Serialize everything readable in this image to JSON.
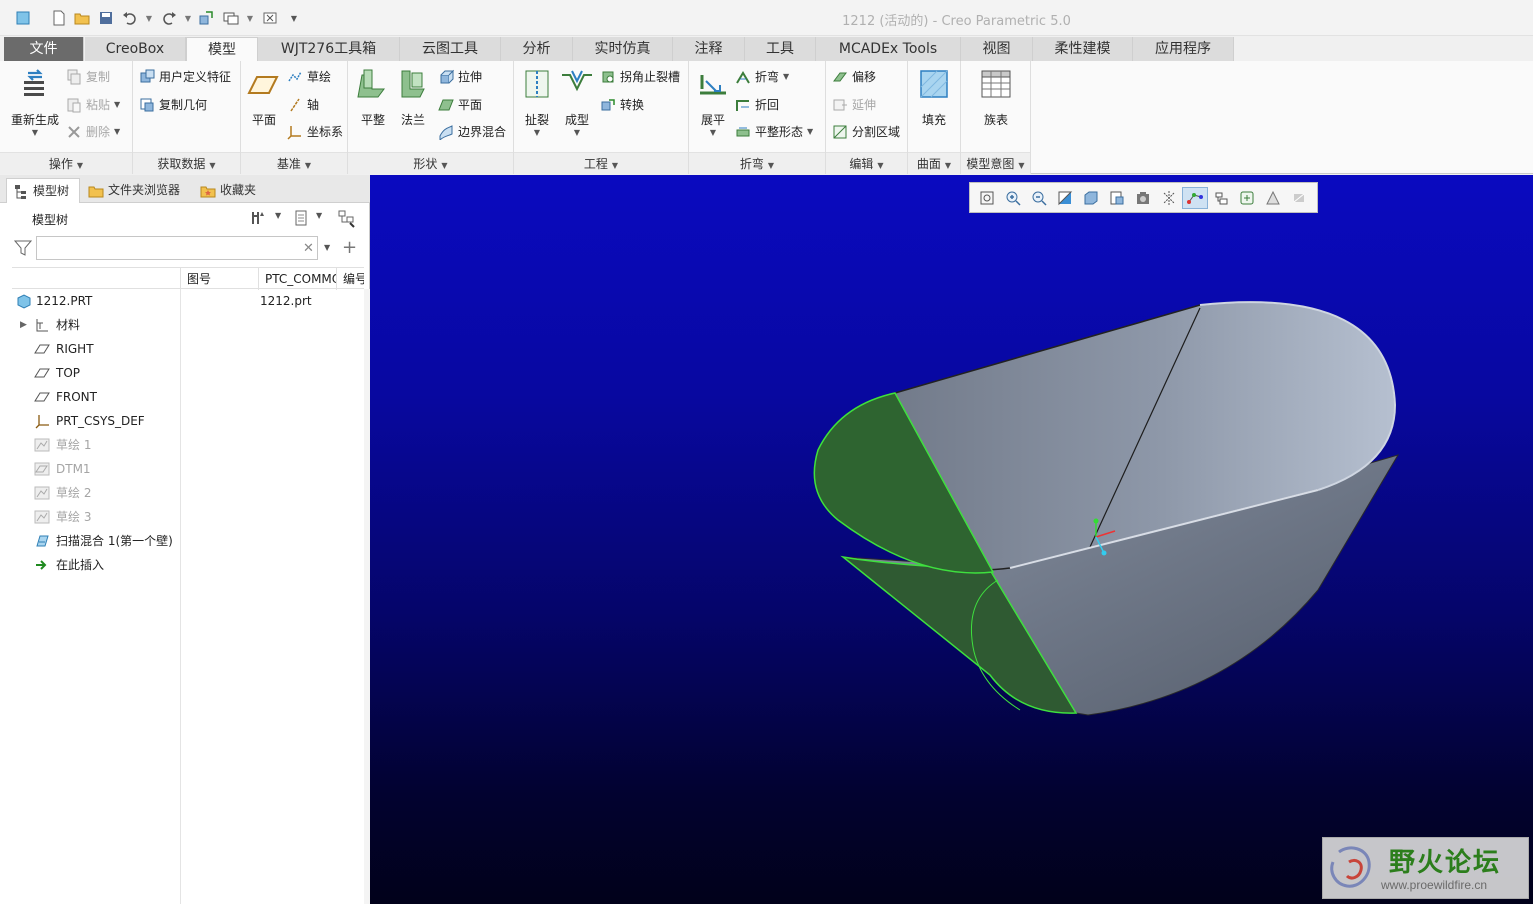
{
  "window": {
    "title": "1212 (活动的) - Creo Parametric 5.0"
  },
  "quick_access": {
    "icons": [
      "app-icon",
      "new-icon",
      "open-icon",
      "save-icon",
      "undo-icon",
      "redo-icon",
      "regenerate-icon",
      "windows-icon",
      "close-window-icon",
      "customize-icon"
    ]
  },
  "tabs": [
    "文件",
    "CreoBox",
    "模型",
    "WJT276工具箱",
    "云图工具",
    "分析",
    "实时仿真",
    "注释",
    "工具",
    "MCADEx Tools",
    "视图",
    "柔性建模",
    "应用程序"
  ],
  "active_tab": "模型",
  "ribbon": {
    "operations": {
      "label": "操作",
      "regen": "重新生成",
      "copy": "复制",
      "paste": "粘贴",
      "delete": "删除"
    },
    "get_data": {
      "label": "获取数据",
      "udf": "用户定义特征",
      "copy_geom": "复制几何"
    },
    "datum": {
      "label": "基准",
      "plane": "平面",
      "sketch": "草绘",
      "axis": "轴",
      "csys": "坐标系"
    },
    "shapes": {
      "label": "形状",
      "flat": "平整",
      "flange": "法兰",
      "extrude": "拉伸",
      "plane": "平面",
      "boundary_blend": "边界混合"
    },
    "engineering": {
      "label": "工程",
      "rip": "扯裂",
      "form": "成型",
      "corner_relief": "拐角止裂槽",
      "convert": "转换"
    },
    "bends": {
      "label": "折弯",
      "unbend": "展平",
      "bend": "折弯",
      "bend_back": "折回",
      "flat_state": "平整形态"
    },
    "editing": {
      "label": "编辑",
      "offset": "偏移",
      "extend": "延伸",
      "split_area": "分割区域"
    },
    "surfaces": {
      "label": "曲面",
      "fill": "填充"
    },
    "model_intent": {
      "label": "模型意图",
      "family_table": "族表"
    }
  },
  "left_panel": {
    "tabs": [
      "模型树",
      "文件夹浏览器",
      "收藏夹"
    ],
    "tree_title": "模型树",
    "search_placeholder": "",
    "columns": [
      "",
      "图号",
      "PTC_COMMON_NAME",
      "编号"
    ],
    "rows": [
      {
        "label": "1212.PRT",
        "icon": "part-icon",
        "dim": false,
        "col2": "1212.prt"
      },
      {
        "label": "材料",
        "icon": "material-icon",
        "dim": false,
        "col2": ""
      },
      {
        "label": "RIGHT",
        "icon": "datum-plane-icon",
        "dim": false,
        "col2": ""
      },
      {
        "label": "TOP",
        "icon": "datum-plane-icon",
        "dim": false,
        "col2": ""
      },
      {
        "label": "FRONT",
        "icon": "datum-plane-icon",
        "dim": false,
        "col2": ""
      },
      {
        "label": "PRT_CSYS_DEF",
        "icon": "csys-icon",
        "dim": false,
        "col2": ""
      },
      {
        "label": "草绘 1",
        "icon": "sketch-icon",
        "dim": true,
        "col2": ""
      },
      {
        "label": "DTM1",
        "icon": "datum-plane-icon",
        "dim": true,
        "col2": ""
      },
      {
        "label": "草绘 2",
        "icon": "sketch-icon",
        "dim": true,
        "col2": ""
      },
      {
        "label": "草绘 3",
        "icon": "sketch-icon",
        "dim": true,
        "col2": ""
      },
      {
        "label": "扫描混合 1(第一个壁)",
        "icon": "swept-blend-icon",
        "dim": false,
        "col2": ""
      },
      {
        "label": "在此插入",
        "icon": "insert-here-icon",
        "dim": false,
        "col2": ""
      }
    ]
  },
  "view_toolbar": {
    "icons": [
      "refit-icon",
      "zoom-in-icon",
      "zoom-out-icon",
      "repaint-icon",
      "display-style-icon",
      "saved-orientations-icon",
      "view-manager-icon",
      "perspective-icon",
      "datum-display-icon",
      "spin-center-icon",
      "annotation-display-icon",
      "sketcher-display-icon",
      "appearance-icon"
    ]
  },
  "watermark": {
    "title": "野火论坛",
    "url": "www.proewildfire.cn"
  },
  "colors": {
    "viewport_top": "#0a0ac0",
    "viewport_bottom": "#01011a",
    "part_grey": "#6a7280",
    "selected_green": "#2f6a2f"
  }
}
